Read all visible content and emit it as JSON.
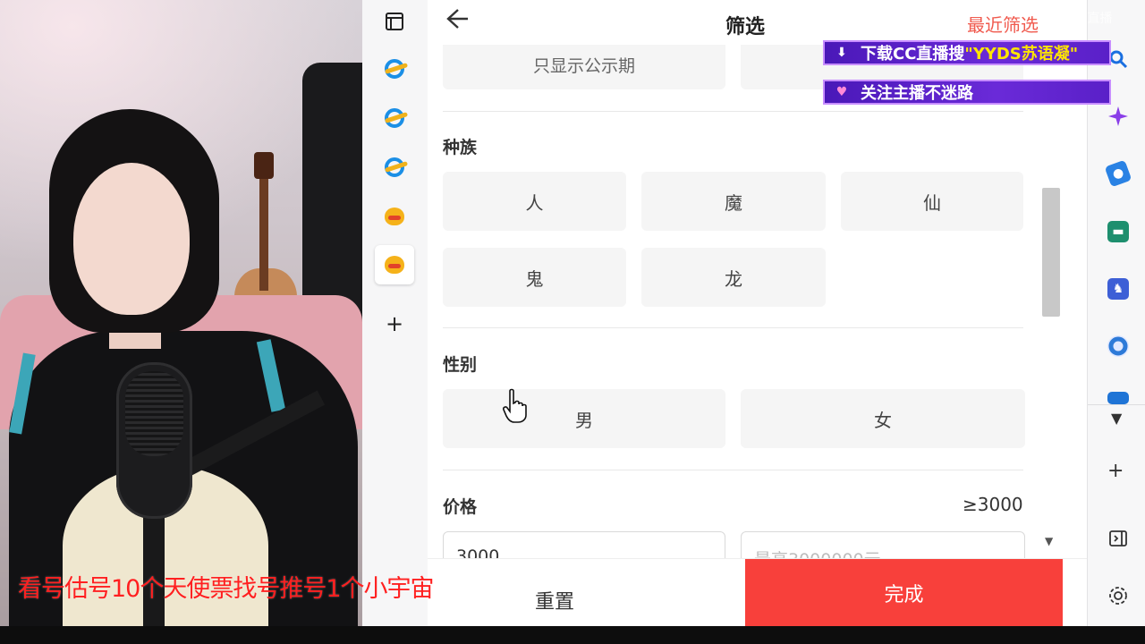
{
  "stream": {
    "caption": "看号估号10个天使票找号推号1个小宇宙",
    "promo_download_prefix": "下载CC直播搜",
    "promo_download_highlight": "\"YYDS苏语凝\"",
    "promo_follow": "关注主播不迷路",
    "watermark": "CC直播"
  },
  "rail": {
    "icons": [
      "tab-panel-icon",
      "ie-icon",
      "ie-icon",
      "ie-icon",
      "chick-icon",
      "chick-icon",
      "plus-icon"
    ],
    "active_index": 5
  },
  "header": {
    "title": "筛选",
    "recent_filter": "最近筛选"
  },
  "filters": {
    "partial_chip": "只显示公示期",
    "race": {
      "title": "种族",
      "options": [
        "人",
        "魔",
        "仙",
        "鬼",
        "龙"
      ]
    },
    "gender": {
      "title": "性别",
      "options": [
        "男",
        "女"
      ]
    },
    "price": {
      "title": "价格",
      "range": "≥3000",
      "min_value": "3000",
      "max_placeholder": "最高3000000元"
    }
  },
  "footer": {
    "reset_label": "重置",
    "done_label": "完成"
  },
  "right_sidebar": {
    "icons": [
      "search-icon",
      "sparkle-icon",
      "tag-icon",
      "toolbox-icon",
      "chess-icon",
      "office-icon",
      "outlook-icon",
      "dropdown-icon",
      "plus-icon",
      "panel-toggle-icon",
      "settings-icon"
    ]
  },
  "colors": {
    "accent_red": "#f8403b",
    "recent_filter_red": "#f05a4e",
    "promo_purple": "#5a20c8",
    "caption_red": "#ff2020"
  }
}
